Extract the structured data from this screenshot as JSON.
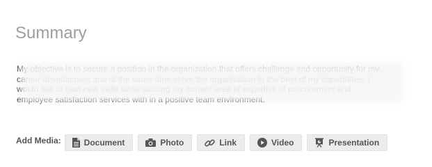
{
  "summary": {
    "title": "Summary",
    "lines": [
      "My objective is to secure a position in the organization that offers challenge and opportunity for my",
      "career development and at the same time serve the organization to the best of my capabilities. I",
      "would like to gain new skills while utilizing my current area of expertise of procurement and",
      "employee satisfaction services with in a positive team environment."
    ]
  },
  "media": {
    "label": "Add Media:",
    "buttons": [
      {
        "label": "Document",
        "icon": "document-icon"
      },
      {
        "label": "Photo",
        "icon": "camera-icon"
      },
      {
        "label": "Link",
        "icon": "link-icon"
      },
      {
        "label": "Video",
        "icon": "play-icon"
      },
      {
        "label": "Presentation",
        "icon": "presentation-icon"
      }
    ]
  },
  "colors": {
    "title": "#9e9e9e",
    "button_bg": "#ececec",
    "button_text": "#555555"
  }
}
